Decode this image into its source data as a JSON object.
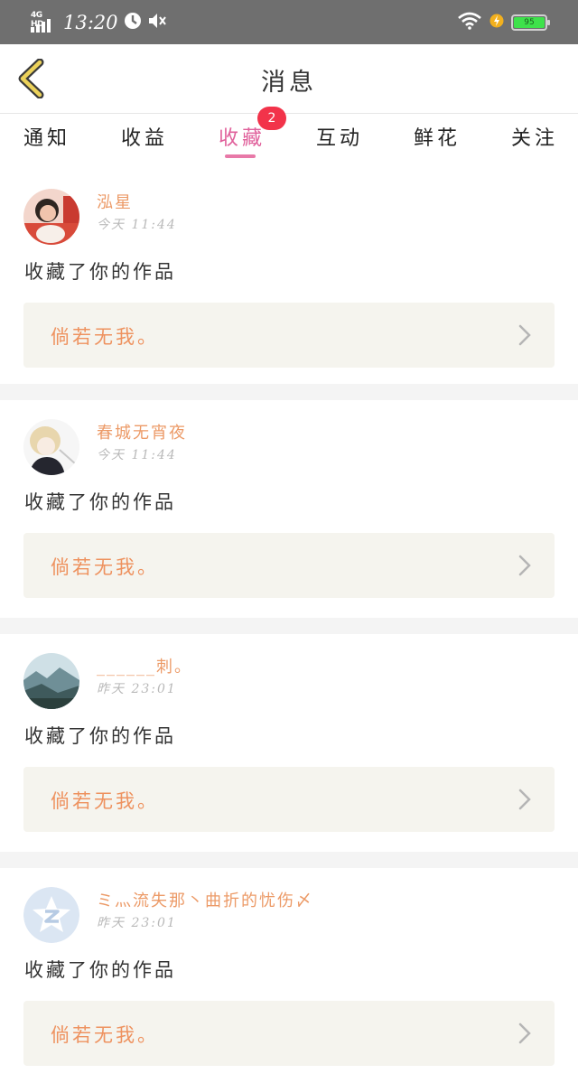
{
  "status_bar": {
    "network": "4G HD",
    "time": "13:20",
    "battery": "95",
    "icons": [
      "signal-icon",
      "alarm-icon",
      "mute-icon",
      "wifi-icon",
      "charging-icon",
      "battery-icon"
    ]
  },
  "header": {
    "title": "消息"
  },
  "tabs": [
    {
      "label": "通知"
    },
    {
      "label": "收益"
    },
    {
      "label": "收藏",
      "active": true,
      "badge": "2"
    },
    {
      "label": "互动"
    },
    {
      "label": "鲜花"
    },
    {
      "label": "关注"
    }
  ],
  "messages": [
    {
      "user": "泓星",
      "time": "今天 11:44",
      "action": "收藏了你的作品",
      "work": "倘若无我。"
    },
    {
      "user": "春城无宵夜",
      "time": "今天 11:44",
      "action": "收藏了你的作品",
      "work": "倘若无我。"
    },
    {
      "user": "______刺。",
      "time": "昨天 23:01",
      "action": "收藏了你的作品",
      "work": "倘若无我。"
    },
    {
      "user": "ミ灬流失那丶曲折的忧伤〆",
      "time": "昨天 23:01",
      "action": "收藏了你的作品",
      "work": "倘若无我。"
    }
  ],
  "colors": {
    "accent": "#e0609b",
    "badge": "#f2334a",
    "name": "#ec9a67",
    "work_title": "#ee925f",
    "work_bg": "#f5f4ee"
  }
}
